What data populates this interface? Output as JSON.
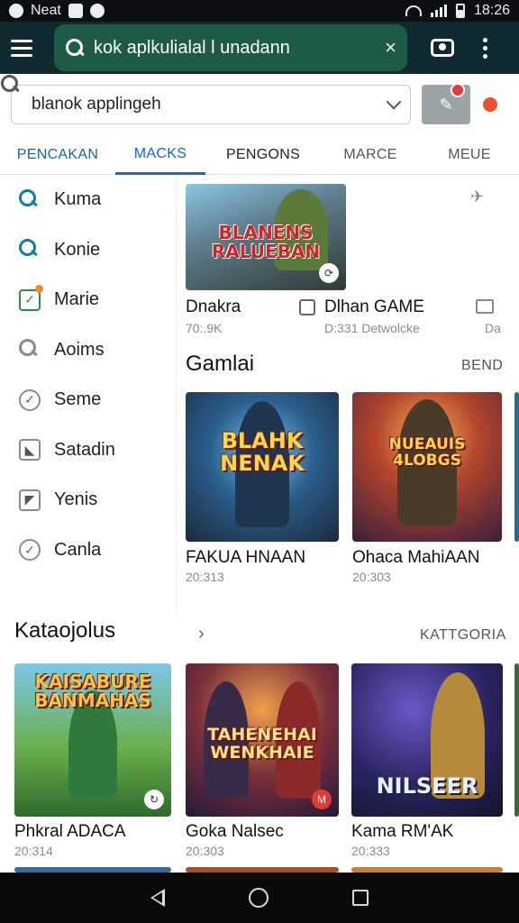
{
  "status_bar": {
    "carrier": "Neat",
    "time": "18:26"
  },
  "app_bar": {
    "search_text": "kok aplkulialal l unadann",
    "close_label": "×"
  },
  "search_row": {
    "query": "blanok applingeh"
  },
  "tabs": [
    {
      "label": "PENCAKAN"
    },
    {
      "label": "MACKS"
    },
    {
      "label": "PENGONS"
    },
    {
      "label": "MARCE"
    },
    {
      "label": "MEUE"
    }
  ],
  "sidebar": {
    "items": [
      {
        "label": "Kuma",
        "icon": "search-icon"
      },
      {
        "label": "Konie",
        "icon": "search-icon"
      },
      {
        "label": "Marie",
        "icon": "checkbox-icon"
      },
      {
        "label": "Aoims",
        "icon": "search-icon"
      },
      {
        "label": "Seme",
        "icon": "check-circle-icon"
      },
      {
        "label": "Satadin",
        "icon": "image-icon"
      },
      {
        "label": "Yenis",
        "icon": "image-icon"
      },
      {
        "label": "Canla",
        "icon": "check-circle-icon"
      }
    ]
  },
  "featured": {
    "thumb_title": "BLANENS RALUEBAN",
    "title": "Dnakra",
    "meta": "70:.9K",
    "secondary_title": "Dlhan GAME",
    "secondary_meta": "D:331 Detwolcke",
    "tertiary_meta": "Da"
  },
  "gamlai": {
    "title": "Gamlai",
    "link": "BEND",
    "cards": [
      {
        "art_title": "BLAHK NENAK",
        "title": "FAKUA HNAAN",
        "meta": "20:313"
      },
      {
        "art_title": "NUEAUIS 4LOBGS",
        "title": "Ohaca MahiAAN",
        "meta": "20:303"
      }
    ]
  },
  "kataojolus": {
    "title": "Kataojolus",
    "link": "KATTGORIA",
    "cards": [
      {
        "art_title": "KAISABURE BANMAHAS",
        "title": "Phkral ADACA",
        "meta": "20:314"
      },
      {
        "art_title": "TAHENEHAI WENKHAIE",
        "title": "Goka Nalsec",
        "meta": "20:303"
      },
      {
        "art_title": "NILSEER",
        "title": "Kama RM'AK",
        "meta": "20:333"
      }
    ]
  },
  "colors": {
    "app_bar": "#0f2a30",
    "search_pill": "#1d5b46",
    "tab_active": "#1565c0"
  }
}
